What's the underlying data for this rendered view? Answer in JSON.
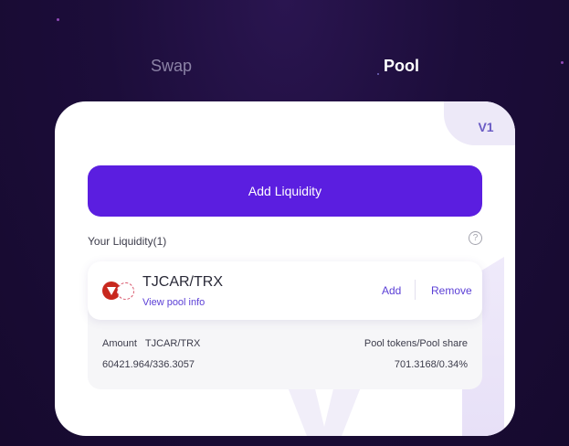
{
  "tabs": [
    {
      "label": "Swap",
      "active": false
    },
    {
      "label": "Pool",
      "active": true
    }
  ],
  "card": {
    "version_badge": "V1",
    "add_liquidity_label": "Add Liquidity",
    "your_liquidity_label": "Your Liquidity(1)",
    "help_icon": "question-circle-icon",
    "help_glyph": "?"
  },
  "position": {
    "pair": "TJCAR/TRX",
    "token_icons": [
      "tron-icon",
      "tjcar-icon"
    ],
    "view_info_label": "View pool info",
    "add_label": "Add",
    "remove_label": "Remove",
    "amount_label": "Amount   TJCAR/TRX",
    "amount_value": "60421.964/336.3057",
    "share_label": "Pool tokens/Pool share",
    "share_value": "701.3168/0.34%"
  },
  "colors": {
    "accent": "#5b1ee0",
    "link": "#5b3fd6",
    "background": "#1c0d3a",
    "badge_bg": "#ede9f8"
  }
}
